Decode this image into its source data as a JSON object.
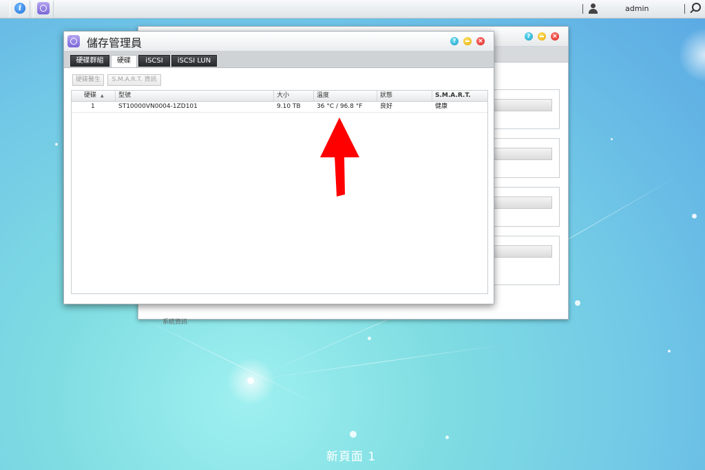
{
  "taskbar": {
    "apps": [
      {
        "name": "info-app",
        "icon": "info-icon"
      },
      {
        "name": "storage-manager-app",
        "icon": "storage-manager-icon"
      }
    ],
    "user_icon": "user-icon",
    "username": "admin",
    "search_icon": "search-icon"
  },
  "window": {
    "title": "儲存管理員",
    "controls": {
      "help": "?",
      "minimize": "minimize",
      "close": "×"
    },
    "tabs": [
      {
        "label": "硬碟群組",
        "active": false
      },
      {
        "label": "硬碟",
        "active": true
      },
      {
        "label": "iSCSI",
        "active": false
      },
      {
        "label": "iSCSI LUN",
        "active": false
      }
    ],
    "toolbar": {
      "health_button": "硬碟醫生",
      "smart_button": "S.M.A.R.T. 資訊"
    },
    "table": {
      "columns": [
        "硬碟",
        "型號",
        "大小",
        "溫度",
        "狀態",
        "S.M.A.R.T."
      ],
      "sort_indicator": "▲",
      "rows": [
        {
          "disk": "1",
          "model": "ST10000VN0004-1ZD101",
          "size": "9.10 TB",
          "temperature": "36 °C / 96.8 °F",
          "status": "良好",
          "smart": "健康"
        }
      ]
    }
  },
  "background_window": {
    "controls": {
      "help": "?",
      "minimize": "minimize",
      "close": "×"
    },
    "footer": "系統資訊"
  },
  "annotation": {
    "arrow_color": "#ff0000",
    "arrow_direction": "up"
  },
  "desktop": {
    "page_label": "新頁面 1"
  }
}
